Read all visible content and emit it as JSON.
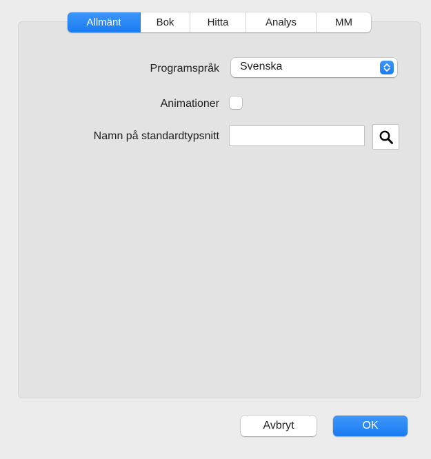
{
  "tabs": [
    {
      "label": "Allmänt",
      "selected": true
    },
    {
      "label": "Bok",
      "selected": false
    },
    {
      "label": "Hitta",
      "selected": false
    },
    {
      "label": "Analys",
      "selected": false
    },
    {
      "label": "MM",
      "selected": false
    }
  ],
  "settings": {
    "program_language": {
      "label": "Programspråk",
      "value": "Svenska",
      "icon": "up-down-chevron-icon"
    },
    "animations": {
      "label": "Animationer",
      "checked": false
    },
    "default_font": {
      "label": "Namn på standardtypsnitt",
      "value": "",
      "icon": "magnifier-icon"
    }
  },
  "buttons": {
    "cancel_label": "Avbryt",
    "ok_label": "OK"
  },
  "colors": {
    "accent": "#1a7cf3",
    "window_bg": "#ececec",
    "panel_bg": "#e3e3e3"
  }
}
